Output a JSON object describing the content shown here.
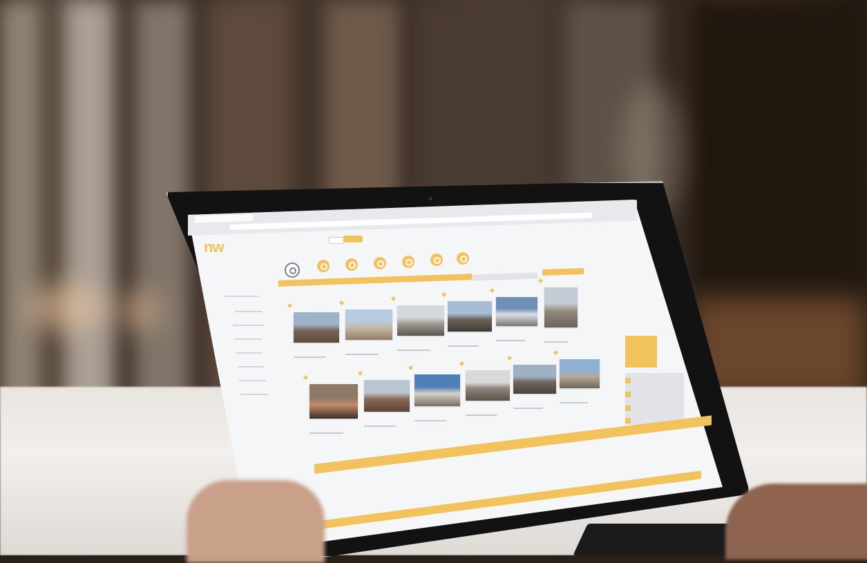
{
  "scene": "laptop-in-library",
  "colors": {
    "accent": "#f2c35c",
    "screen_bg": "#f5f6f8",
    "bezel": "#121212"
  },
  "app": {
    "logo_text": "nw",
    "browser_tab": "",
    "address": ""
  },
  "nav": {
    "icons": [
      {
        "icon": "home-icon"
      },
      {
        "icon": "circle-icon"
      },
      {
        "icon": "circle-icon"
      },
      {
        "icon": "circle-icon"
      },
      {
        "icon": "circle-icon"
      },
      {
        "icon": "circle-icon"
      },
      {
        "icon": "cart-icon"
      }
    ]
  },
  "gallery": {
    "rows": [
      [
        {
          "palette": [
            "#9db3c9",
            "#7a6655",
            "#5b4a3c"
          ]
        },
        {
          "palette": [
            "#b7cbe0",
            "#c6b8a2",
            "#8e7c69"
          ]
        },
        {
          "palette": [
            "#d3d9de",
            "#9f9a92",
            "#5e574f"
          ]
        },
        {
          "palette": [
            "#a8bdd3",
            "#6c6459",
            "#3f3a35"
          ]
        },
        {
          "palette": [
            "#6e8fb6",
            "#dcdfe3",
            "#7d7670"
          ]
        },
        {
          "palette": [
            "#c3ccd4",
            "#948a7e",
            "#6b6359"
          ]
        }
      ],
      [
        {
          "palette": [
            "#8f7865",
            "#c28a6a",
            "#3c2f27"
          ]
        },
        {
          "palette": [
            "#b9c6d1",
            "#8a6a57",
            "#5a4538"
          ]
        },
        {
          "palette": [
            "#4e7fb6",
            "#d6d2cc",
            "#7a6c5e"
          ]
        },
        {
          "palette": [
            "#dad9d7",
            "#8d8479",
            "#5b5248"
          ]
        },
        {
          "palette": [
            "#9fb1c3",
            "#6f665d",
            "#4a433c"
          ]
        },
        {
          "palette": [
            "#8fb2d4",
            "#b7aa98",
            "#6f655a"
          ]
        }
      ]
    ]
  }
}
